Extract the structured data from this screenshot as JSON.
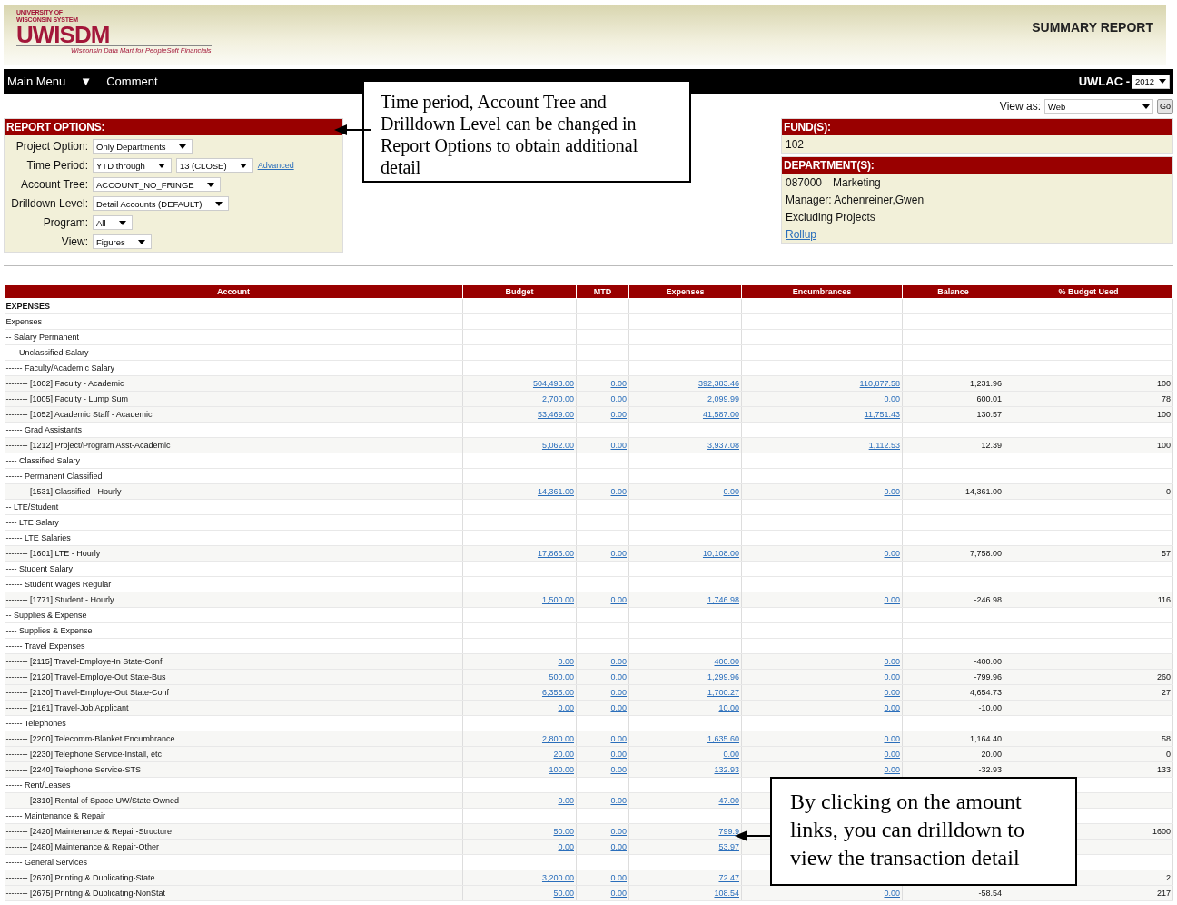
{
  "header": {
    "logo": {
      "line_1": "UNIVERSITY OF",
      "line_2": "WISCONSIN SYSTEM",
      "wordmark": "UWISDM",
      "tagline": "Wisconsin Data Mart for PeopleSoft Financials"
    },
    "title": "SUMMARY REPORT"
  },
  "nav": {
    "items": [
      {
        "kind": "text",
        "text": "Main Menu"
      },
      {
        "kind": "text",
        "text": "▼"
      },
      {
        "kind": "text",
        "text": "Comment"
      }
    ],
    "org": "UWLAC -",
    "year": "2012"
  },
  "view_as": {
    "label": "View as:",
    "value": "Web",
    "button": "Go"
  },
  "report_options": {
    "title": "REPORT OPTIONS:",
    "rows": [
      {
        "label": "Project Option:",
        "controls": [
          {
            "kind": "select",
            "value": "Only Departments"
          }
        ]
      },
      {
        "label": "Time Period:",
        "controls": [
          {
            "kind": "select",
            "value": "YTD through"
          },
          {
            "kind": "select",
            "value": "13 (CLOSE)"
          },
          {
            "kind": "link",
            "text": "Advanced"
          }
        ]
      },
      {
        "label": "Account Tree:",
        "controls": [
          {
            "kind": "select",
            "value": "ACCOUNT_NO_FRINGE"
          }
        ]
      },
      {
        "label": "Drilldown Level:",
        "controls": [
          {
            "kind": "select",
            "value": "Detail Accounts (DEFAULT)"
          }
        ]
      },
      {
        "label": "Program:",
        "controls": [
          {
            "kind": "select",
            "value": "All"
          }
        ]
      },
      {
        "label": "View:",
        "controls": [
          {
            "kind": "select",
            "value": "Figures"
          }
        ]
      }
    ]
  },
  "funds": {
    "title": "FUND(S):",
    "value": "102"
  },
  "departments": {
    "title": "DEPARTMENT(S):",
    "code": "087000",
    "name": "Marketing",
    "manager": "Manager: Achenreiner,Gwen",
    "note": "Excluding Projects",
    "link": "Rollup"
  },
  "table": {
    "columns": [
      "Account",
      "Budget",
      "MTD",
      "Expenses",
      "Encumbrances",
      "Balance",
      "% Budget Used"
    ],
    "rows": [
      {
        "kind": "section",
        "account": "EXPENSES"
      },
      {
        "kind": "group",
        "account": "Expenses"
      },
      {
        "kind": "group",
        "account": "-- Salary Permanent"
      },
      {
        "kind": "group",
        "account": "---- Unclassified Salary"
      },
      {
        "kind": "group",
        "account": "------ Faculty/Academic Salary"
      },
      {
        "kind": "line",
        "account": "-------- [1002] Faculty - Academic",
        "budget": "504,493.00",
        "mtd": "0.00",
        "expenses": "392,383.46",
        "encumbrances": "110,877.58",
        "balance": "1,231.96",
        "pct": "100"
      },
      {
        "kind": "line",
        "account": "-------- [1005] Faculty - Lump Sum",
        "budget": "2,700.00",
        "mtd": "0.00",
        "expenses": "2,099.99",
        "encumbrances": "0.00",
        "balance": "600.01",
        "pct": "78"
      },
      {
        "kind": "line",
        "account": "-------- [1052] Academic Staff - Academic",
        "budget": "53,469.00",
        "mtd": "0.00",
        "expenses": "41,587.00",
        "encumbrances": "11,751.43",
        "balance": "130.57",
        "pct": "100"
      },
      {
        "kind": "group",
        "account": "------ Grad Assistants"
      },
      {
        "kind": "line",
        "account": "-------- [1212] Project/Program Asst-Academic",
        "budget": "5,062.00",
        "mtd": "0.00",
        "expenses": "3,937.08",
        "encumbrances": "1,112.53",
        "balance": "12.39",
        "pct": "100"
      },
      {
        "kind": "group",
        "account": "---- Classified Salary"
      },
      {
        "kind": "group",
        "account": "------ Permanent Classified"
      },
      {
        "kind": "line",
        "account": "-------- [1531] Classified - Hourly",
        "budget": "14,361.00",
        "mtd": "0.00",
        "expenses": "0.00",
        "encumbrances": "0.00",
        "balance": "14,361.00",
        "pct": "0"
      },
      {
        "kind": "group",
        "account": "-- LTE/Student"
      },
      {
        "kind": "group",
        "account": "---- LTE Salary"
      },
      {
        "kind": "group",
        "account": "------ LTE Salaries"
      },
      {
        "kind": "line",
        "account": "-------- [1601] LTE - Hourly",
        "budget": "17,866.00",
        "mtd": "0.00",
        "expenses": "10,108.00",
        "encumbrances": "0.00",
        "balance": "7,758.00",
        "pct": "57"
      },
      {
        "kind": "group",
        "account": "---- Student Salary"
      },
      {
        "kind": "group",
        "account": "------ Student Wages Regular"
      },
      {
        "kind": "line",
        "account": "-------- [1771] Student - Hourly",
        "budget": "1,500.00",
        "mtd": "0.00",
        "expenses": "1,746.98",
        "encumbrances": "0.00",
        "balance": "-246.98",
        "pct": "116"
      },
      {
        "kind": "group",
        "account": "-- Supplies & Expense"
      },
      {
        "kind": "group",
        "account": "---- Supplies & Expense"
      },
      {
        "kind": "group",
        "account": "------ Travel Expenses"
      },
      {
        "kind": "line",
        "account": "-------- [2115] Travel-Employe-In State-Conf",
        "budget": "0.00",
        "mtd": "0.00",
        "expenses": "400.00",
        "encumbrances": "0.00",
        "balance": "-400.00"
      },
      {
        "kind": "line",
        "account": "-------- [2120] Travel-Employe-Out State-Bus",
        "budget": "500.00",
        "mtd": "0.00",
        "expenses": "1,299.96",
        "encumbrances": "0.00",
        "balance": "-799.96",
        "pct": "260"
      },
      {
        "kind": "line",
        "account": "-------- [2130] Travel-Employe-Out State-Conf",
        "budget": "6,355.00",
        "mtd": "0.00",
        "expenses": "1,700.27",
        "encumbrances": "0.00",
        "balance": "4,654.73",
        "pct": "27"
      },
      {
        "kind": "line",
        "account": "-------- [2161] Travel-Job Applicant",
        "budget": "0.00",
        "mtd": "0.00",
        "expenses": "10.00",
        "encumbrances": "0.00",
        "balance": "-10.00"
      },
      {
        "kind": "group",
        "account": "------ Telephones"
      },
      {
        "kind": "line",
        "account": "-------- [2200] Telecomm-Blanket Encumbrance",
        "budget": "2,800.00",
        "mtd": "0.00",
        "expenses": "1,635.60",
        "encumbrances": "0.00",
        "balance": "1,164.40",
        "pct": "58"
      },
      {
        "kind": "line",
        "account": "-------- [2230] Telephone Service-Install, etc",
        "budget": "20.00",
        "mtd": "0.00",
        "expenses": "0.00",
        "encumbrances": "0.00",
        "balance": "20.00",
        "pct": "0"
      },
      {
        "kind": "line",
        "account": "-------- [2240] Telephone Service-STS",
        "budget": "100.00",
        "mtd": "0.00",
        "expenses": "132.93",
        "encumbrances": "0.00",
        "balance": "-32.93",
        "pct": "133"
      },
      {
        "kind": "group",
        "account": "------ Rent/Leases"
      },
      {
        "kind": "line",
        "account": "-------- [2310] Rental of Space-UW/State Owned",
        "budget": "0.00",
        "mtd": "0.00",
        "expenses": "47.00"
      },
      {
        "kind": "group",
        "account": "------ Maintenance & Repair"
      },
      {
        "kind": "line",
        "account": "-------- [2420] Maintenance & Repair-Structure",
        "budget": "50.00",
        "mtd": "0.00",
        "expenses": "799.9",
        "pct": "1600"
      },
      {
        "kind": "line",
        "account": "-------- [2480] Maintenance & Repair-Other",
        "budget": "0.00",
        "mtd": "0.00",
        "expenses": "53.97"
      },
      {
        "kind": "group",
        "account": "------ General Services"
      },
      {
        "kind": "line",
        "account": "-------- [2670] Printing & Duplicating-State",
        "budget": "3,200.00",
        "mtd": "0.00",
        "expenses": "72.47",
        "pct": "2"
      },
      {
        "kind": "line",
        "account": "-------- [2675] Printing & Duplicating-NonStat",
        "budget": "50.00",
        "mtd": "0.00",
        "expenses": "108.54",
        "encumbrances": "0.00",
        "balance": "-58.54",
        "pct": "217"
      }
    ]
  },
  "callouts": [
    {
      "text": "Time period, Account Tree and Drilldown Level can be changed in Report Options to obtain additional detail"
    },
    {
      "text": "By clicking on the amount links, you can drilldown to view the transaction detail"
    }
  ]
}
